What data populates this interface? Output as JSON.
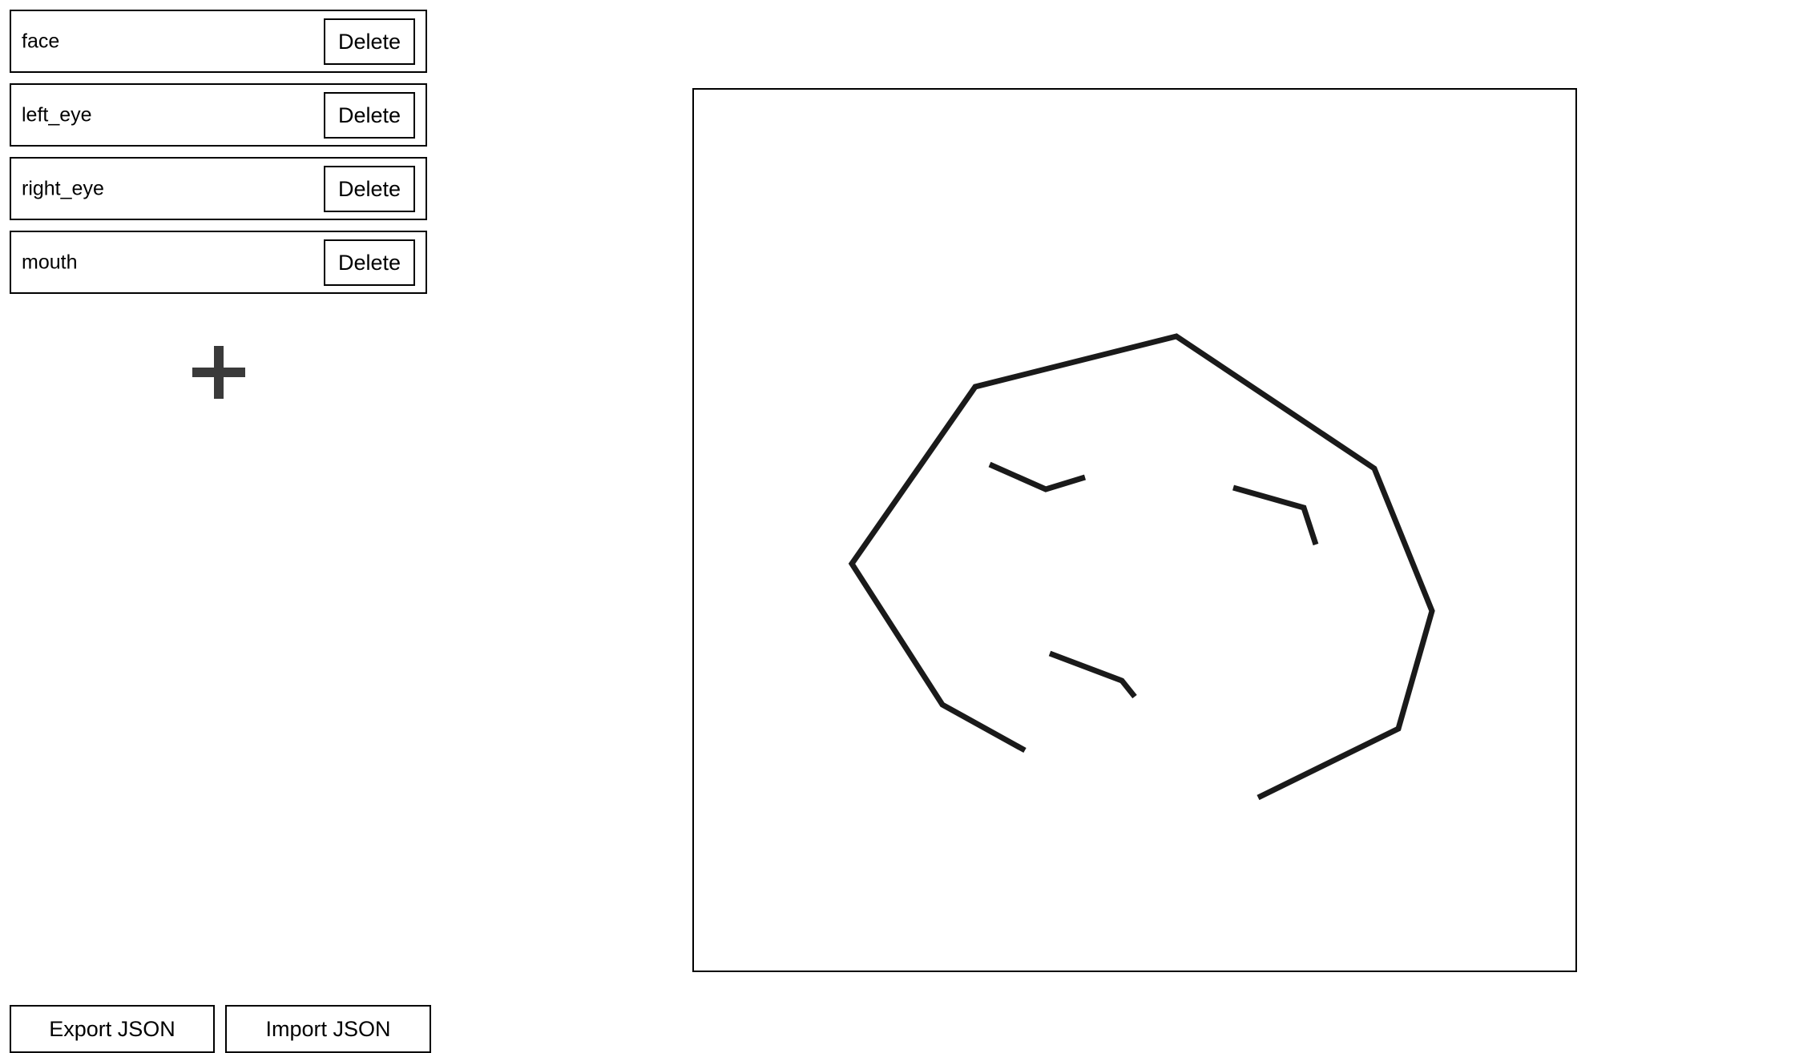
{
  "shapes": [
    {
      "name": "face",
      "delete_label": "Delete"
    },
    {
      "name": "left_eye",
      "delete_label": "Delete"
    },
    {
      "name": "right_eye",
      "delete_label": "Delete"
    },
    {
      "name": "mouth",
      "delete_label": "Delete"
    }
  ],
  "add_button": {
    "icon": "plus-icon"
  },
  "footer": {
    "export_label": "Export JSON",
    "import_label": "Import JSON"
  },
  "colors": {
    "stroke": "#1a1a1a",
    "add_icon": "#3a3a3a"
  }
}
